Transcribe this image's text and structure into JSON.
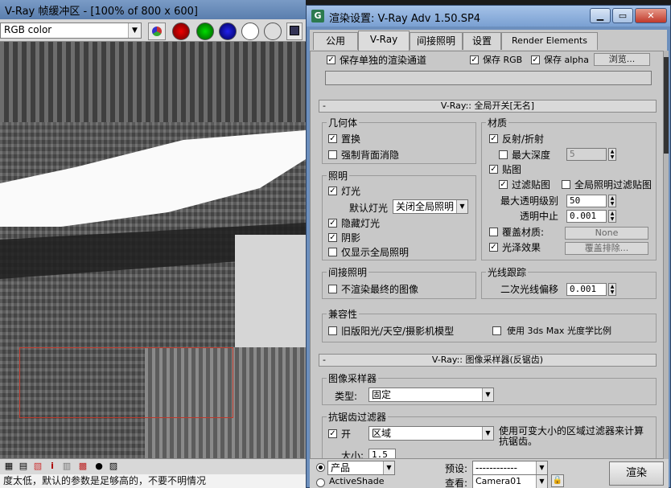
{
  "framebuffer": {
    "title": "V-Ray 帧缓冲区 - [100% of 800 x 600]",
    "channel": "RGB color",
    "status_text": "度太低，默认的参数是足够高的，不要不明情况"
  },
  "dialog": {
    "title": "渲染设置: V-Ray Adv 1.50.SP4",
    "window_buttons": {
      "minimize": "▁",
      "restore": "▭",
      "close": "✕"
    },
    "tabs": [
      "公用",
      "V-Ray",
      "间接照明",
      "设置",
      "Render Elements"
    ],
    "top_row": {
      "save_separate": "保存单独的渲染通道",
      "save_rgb": "保存 RGB",
      "save_alpha": "保存 alpha",
      "browse": "浏览..."
    },
    "global_switches": {
      "header": "V-Ray:: 全局开关[无名]",
      "geometry": {
        "label": "几何体",
        "displacement": "置换",
        "force_backface": "强制背面消隐"
      },
      "lighting": {
        "label": "照明",
        "lights": "灯光",
        "default_lights_label": "默认灯光",
        "default_lights_value": "关闭全局照明",
        "hidden_lights": "隐藏灯光",
        "shadows": "阴影",
        "show_gi_only": "仅显示全局照明"
      },
      "materials": {
        "label": "材质",
        "reflect_refract": "反射/折射",
        "max_depth_label": "最大深度",
        "max_depth": "5",
        "maps": "贴图",
        "filter_maps": "过滤贴图",
        "filter_gi": "全局照明过滤贴图",
        "max_transp_label": "最大透明级别",
        "max_transp": "50",
        "transp_cutoff_label": "透明中止",
        "transp_cutoff": "0.001",
        "override_mtl": "覆盖材质:",
        "override_btn": "None",
        "glossy": "光泽效果",
        "override_exclude": "覆盖排除..."
      },
      "indirect": {
        "label": "间接照明",
        "no_render_final": "不渲染最终的图像"
      },
      "raytracing": {
        "label": "光线跟踪",
        "secondary_bias_label": "二次光线偏移",
        "secondary_bias": "0.001"
      },
      "compat": {
        "label": "兼容性",
        "legacy_sun": "旧版阳光/天空/摄影机模型",
        "use_3dsmax_photometric": "使用 3ds Max 光度学比例"
      }
    },
    "image_sampler": {
      "header": "V-Ray:: 图像采样器(反锯齿)",
      "sampler_group": "图像采样器",
      "type_label": "类型:",
      "type_value": "固定",
      "aa_group": "抗锯齿过滤器",
      "aa_on": "开",
      "aa_filter": "区域",
      "aa_desc": "使用可变大小的区域过滤器来计算抗锯齿。",
      "size_label": "大小:",
      "size_value": "1.5"
    },
    "footer": {
      "product": "产品",
      "activeshade": "ActiveShade",
      "preset_label": "预设:",
      "preset_value": "------------",
      "view_label": "查看:",
      "view_value": "Camera01",
      "render": "渲染"
    }
  }
}
